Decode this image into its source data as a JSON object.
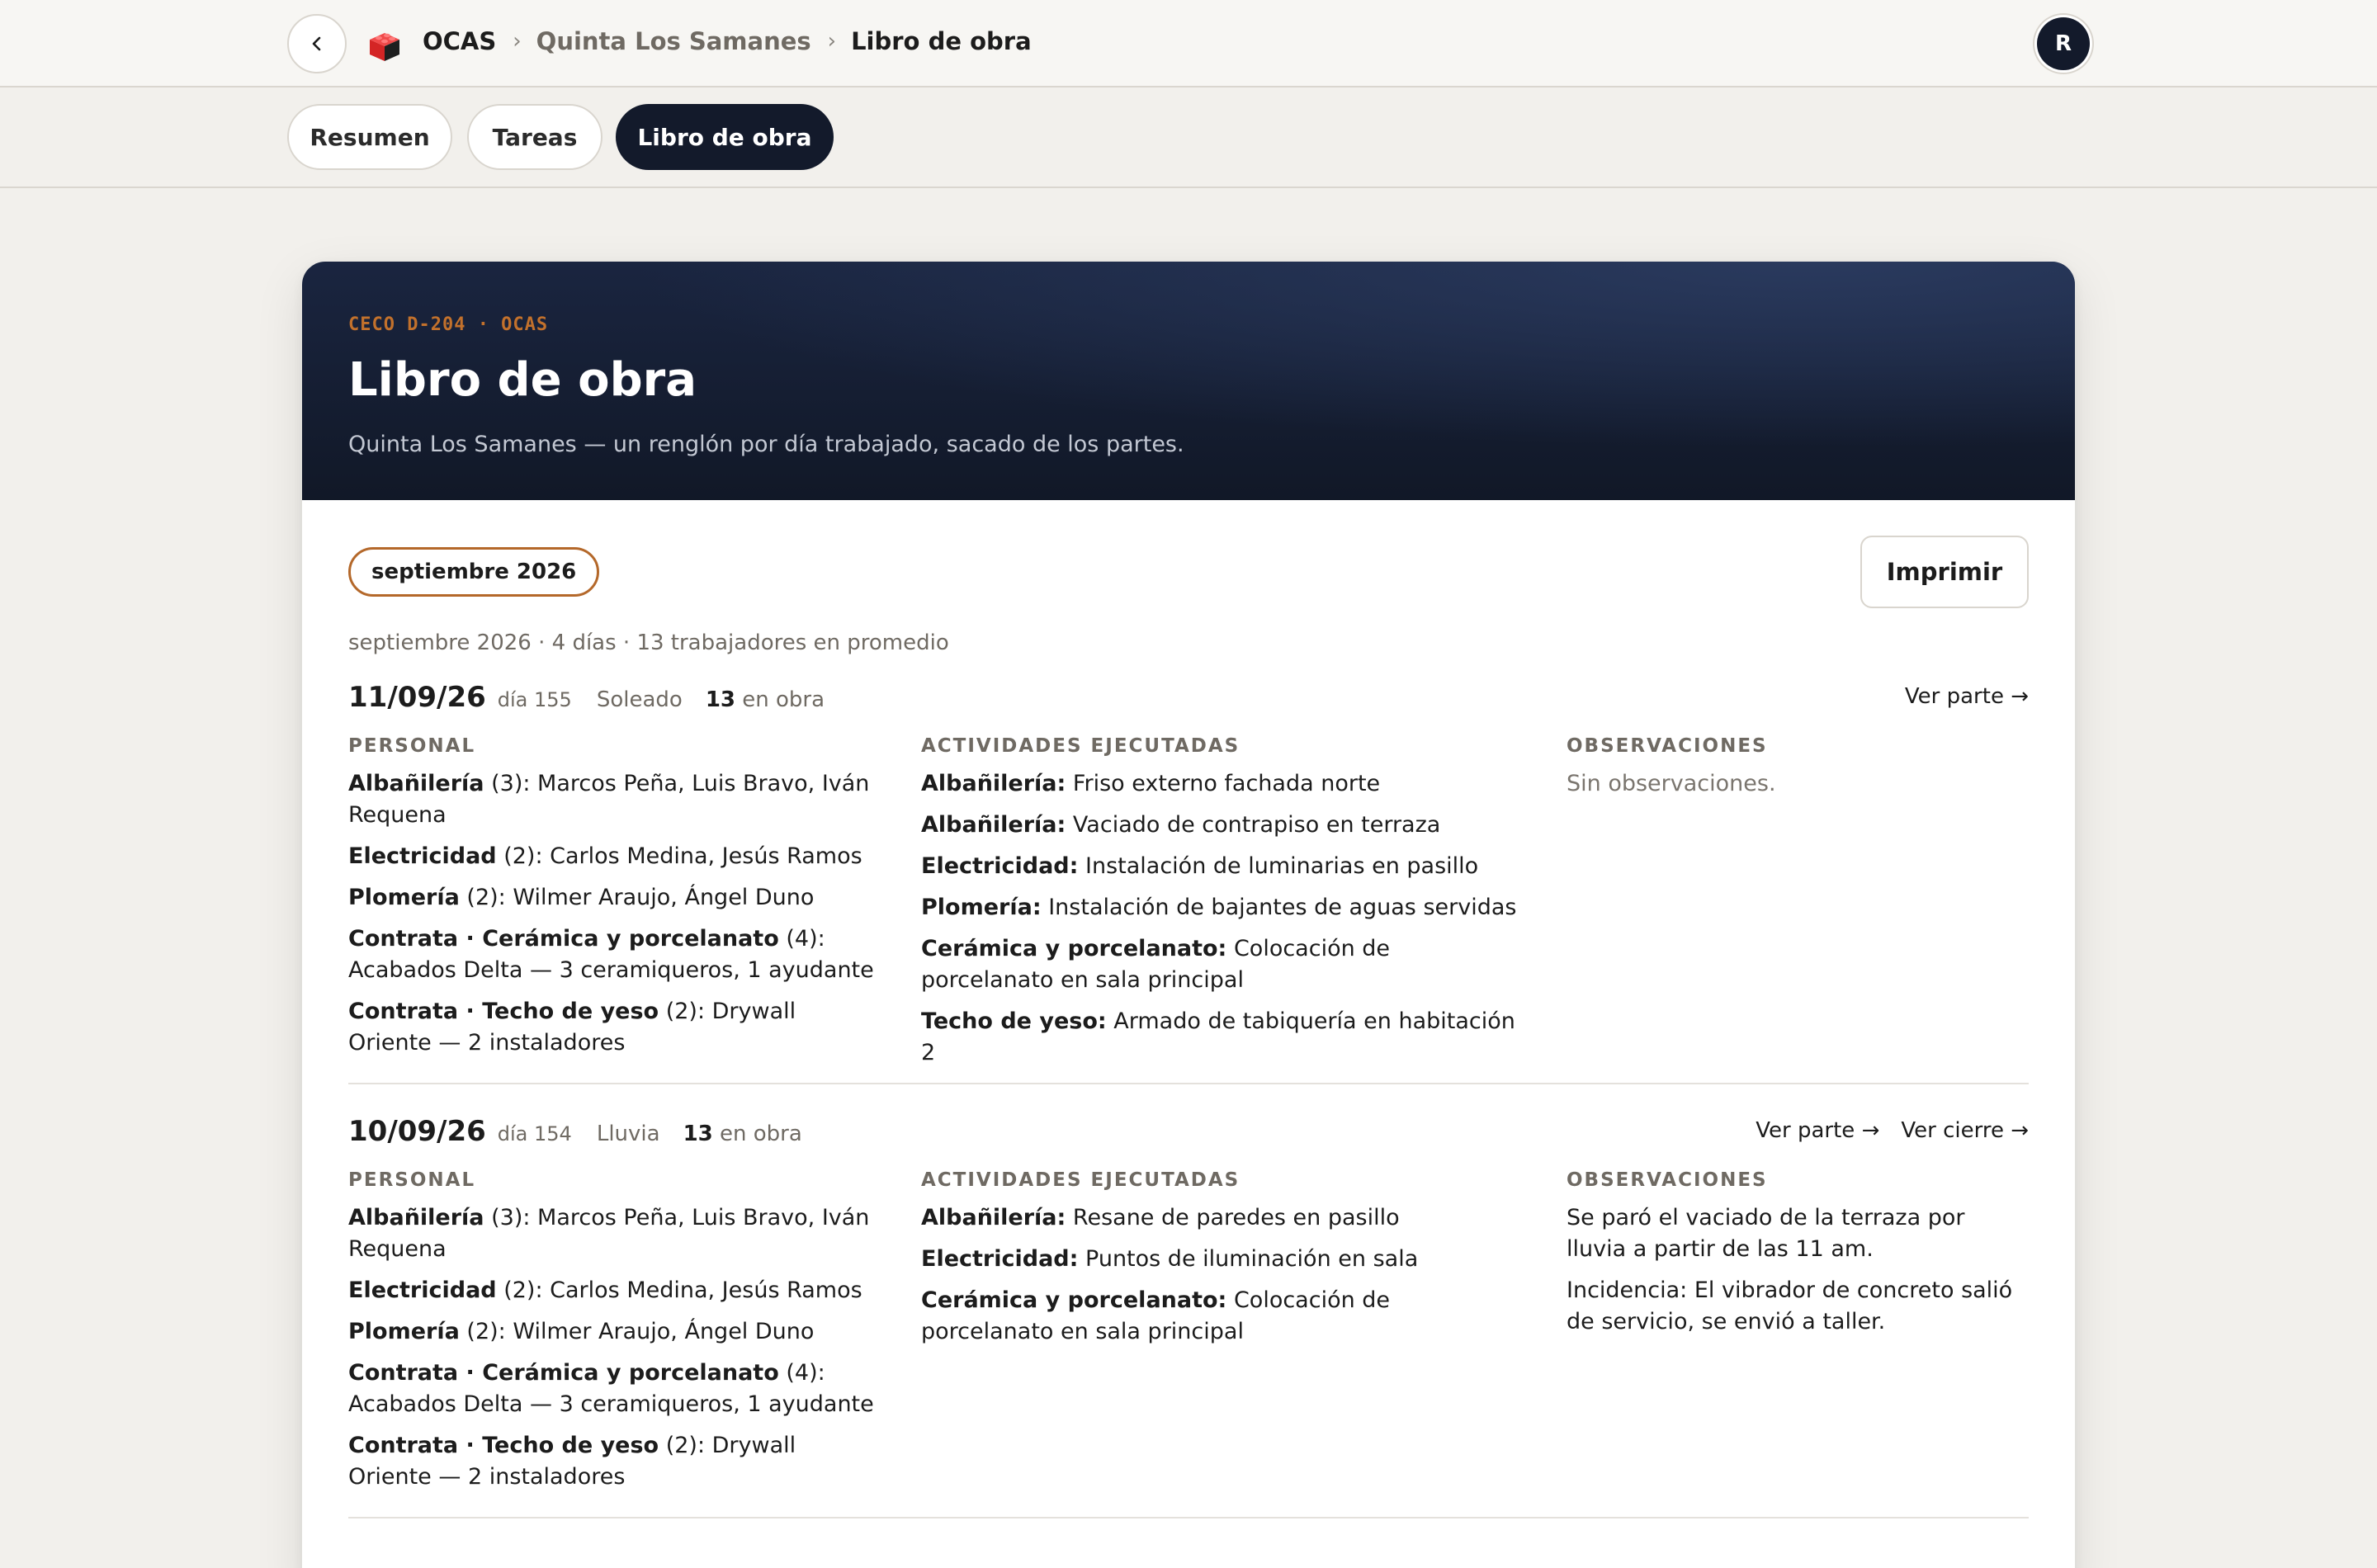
{
  "breadcrumb": {
    "root": "OCAS",
    "project": "Quinta Los Samanes",
    "current": "Libro de obra",
    "sep": "›"
  },
  "user": {
    "avatar_initial": "R"
  },
  "tabs": [
    {
      "label": "Resumen",
      "active": false
    },
    {
      "label": "Tareas",
      "active": false
    },
    {
      "label": "Libro de obra",
      "active": true
    }
  ],
  "hero": {
    "eyebrow": "CECO D-204 · OCAS",
    "title": "Libro de obra",
    "subtitle": "Quinta Los Samanes — un renglón por día trabajado, sacado de los partes."
  },
  "controls": {
    "month": "septiembre 2026",
    "print_label": "Imprimir"
  },
  "summary": "septiembre 2026 · 4 días · 13 trabajadores en promedio",
  "column_headers": {
    "personal": "PERSONAL",
    "activities": "ACTIVIDADES EJECUTADAS",
    "observations": "OBSERVACIONES"
  },
  "entries": [
    {
      "date": "11/09/26",
      "day": "día 155",
      "weather": "Soleado",
      "workers": "13",
      "workers_suffix": " en obra",
      "links": [
        "Ver parte →"
      ],
      "personal": [
        {
          "role": "Albañilería",
          "detail": " (3): Marcos Peña, Luis Bravo, Iván Requena"
        },
        {
          "role": "Electricidad",
          "detail": " (2): Carlos Medina, Jesús Ramos"
        },
        {
          "role": "Plomería",
          "detail": " (2): Wilmer Araujo, Ángel Duno"
        },
        {
          "role": "Contrata · Cerámica y porcelanato",
          "detail": " (4): Acabados Delta — 3 ceramiqueros, 1 ayudante"
        },
        {
          "role": "Contrata · Techo de yeso",
          "detail": " (2): Drywall Oriente — 2 instaladores"
        }
      ],
      "activities": [
        {
          "trade": "Albañilería:",
          "text": " Friso externo fachada norte"
        },
        {
          "trade": "Albañilería:",
          "text": " Vaciado de contrapiso en terraza"
        },
        {
          "trade": "Electricidad:",
          "text": " Instalación de luminarias en pasillo"
        },
        {
          "trade": "Plomería:",
          "text": " Instalación de bajantes de aguas servidas"
        },
        {
          "trade": "Cerámica y porcelanato:",
          "text": " Colocación de porcelanato en sala principal"
        },
        {
          "trade": "Techo de yeso:",
          "text": " Armado de tabiquería en habitación 2"
        }
      ],
      "observations": [
        "Sin observaciones."
      ],
      "observations_muted": true
    },
    {
      "date": "10/09/26",
      "day": "día 154",
      "weather": "Lluvia",
      "workers": "13",
      "workers_suffix": " en obra",
      "links": [
        "Ver parte →",
        "Ver cierre →"
      ],
      "personal": [
        {
          "role": "Albañilería",
          "detail": " (3): Marcos Peña, Luis Bravo, Iván Requena"
        },
        {
          "role": "Electricidad",
          "detail": " (2): Carlos Medina, Jesús Ramos"
        },
        {
          "role": "Plomería",
          "detail": " (2): Wilmer Araujo, Ángel Duno"
        },
        {
          "role": "Contrata · Cerámica y porcelanato",
          "detail": " (4): Acabados Delta — 3 ceramiqueros, 1 ayudante"
        },
        {
          "role": "Contrata · Techo de yeso",
          "detail": " (2): Drywall Oriente — 2 instaladores"
        }
      ],
      "activities": [
        {
          "trade": "Albañilería:",
          "text": " Resane de paredes en pasillo"
        },
        {
          "trade": "Electricidad:",
          "text": " Puntos de iluminación en sala"
        },
        {
          "trade": "Cerámica y porcelanato:",
          "text": " Colocación de porcelanato en sala principal"
        }
      ],
      "observations": [
        "Se paró el vaciado de la terraza por lluvia a partir de las 11 am.",
        "Incidencia: El vibrador de concreto salió de servicio, se envió a taller."
      ],
      "observations_muted": false
    }
  ]
}
